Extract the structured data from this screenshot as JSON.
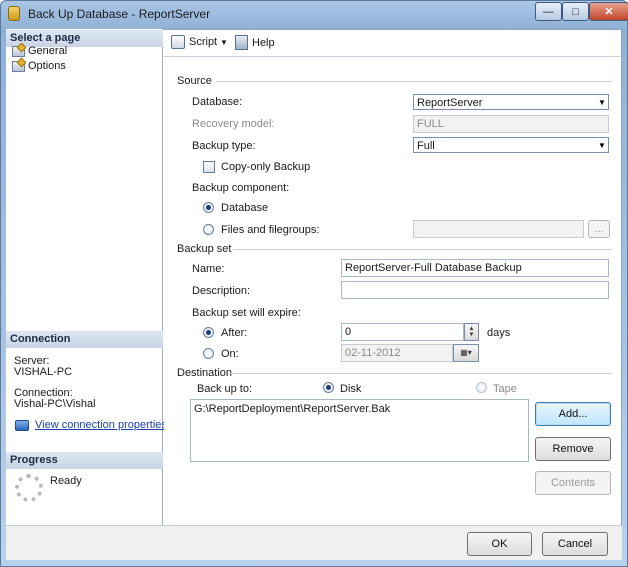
{
  "window": {
    "title": "Back Up Database - ReportServer",
    "minimize_glyph": "—",
    "maximize_glyph": "□",
    "close_glyph": "✕"
  },
  "left_panel": {
    "select_page_header": "Select a page",
    "pages": [
      {
        "label": "General",
        "icon": "page-icon"
      },
      {
        "label": "Options",
        "icon": "page-icon"
      }
    ],
    "connection_header": "Connection",
    "server_label": "Server:",
    "server_value": "VISHAL-PC",
    "connection_label": "Connection:",
    "connection_value": "Vishal-PC\\Vishal",
    "view_connection_link": "View connection properties",
    "progress_header": "Progress",
    "progress_status": "Ready"
  },
  "toolbar": {
    "script_label": "Script",
    "script_dropdown_glyph": "▼",
    "help_label": "Help"
  },
  "source": {
    "header": "Source",
    "database_label": "Database:",
    "database_value": "ReportServer",
    "recovery_model_label": "Recovery model:",
    "recovery_model_value": "FULL",
    "backup_type_label": "Backup type:",
    "backup_type_value": "Full",
    "copy_only_label": "Copy-only Backup",
    "backup_component_label": "Backup component:",
    "component_database_label": "Database",
    "component_files_label": "Files and filegroups:",
    "browse_label": "..."
  },
  "backup_set": {
    "header": "Backup set",
    "name_label": "Name:",
    "name_value": "ReportServer-Full Database Backup",
    "description_label": "Description:",
    "description_value": "",
    "expire_label": "Backup set will expire:",
    "after_label": "After:",
    "after_value": "0",
    "days_label": "days",
    "on_label": "On:",
    "on_value": "02-11-2012"
  },
  "destination": {
    "header": "Destination",
    "back_up_to_label": "Back up to:",
    "disk_label": "Disk",
    "tape_label": "Tape",
    "items": [
      "G:\\ReportDeployment\\ReportServer.Bak"
    ],
    "add_label": "Add...",
    "remove_label": "Remove",
    "contents_label": "Contents"
  },
  "footer": {
    "ok_label": "OK",
    "cancel_label": "Cancel"
  },
  "colors": {
    "title_bar": "#a9c6e6",
    "section_header": "#dde6f1",
    "link": "#1b3fa8",
    "close_button": "#c0462a"
  }
}
